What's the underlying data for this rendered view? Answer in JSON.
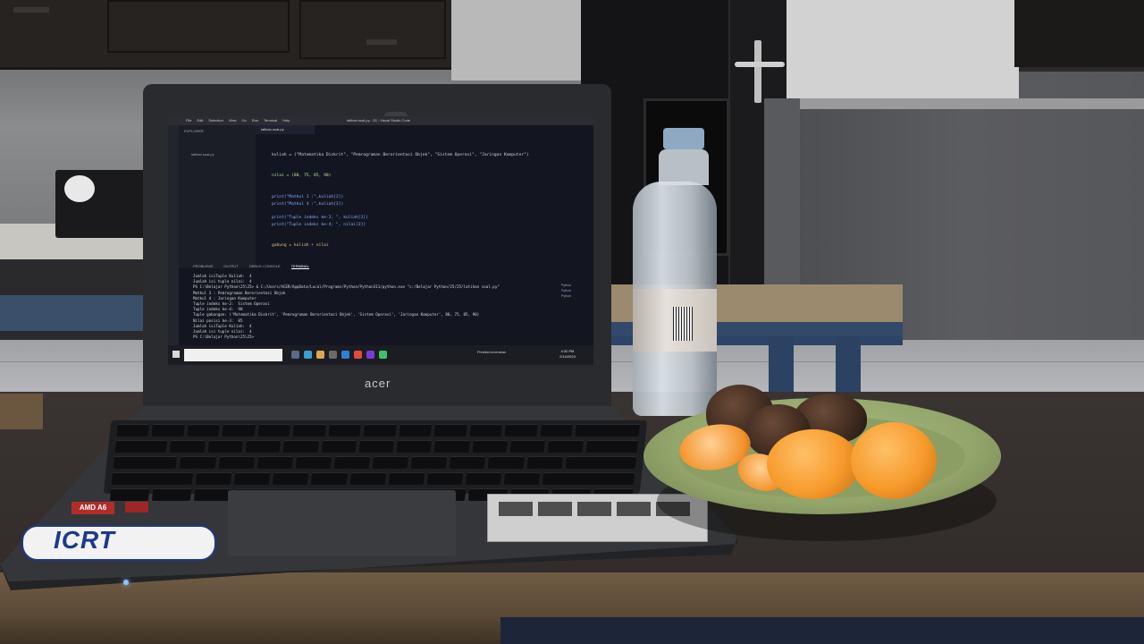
{
  "scene": {
    "laptop_brand": "acer",
    "sticker_badge": "AMD A6",
    "sticker_brand": "ICRT"
  },
  "vscode": {
    "menu": [
      "File",
      "Edit",
      "Selection",
      "View",
      "Go",
      "Run",
      "Terminal",
      "Help"
    ],
    "window_title": "latihan soal.py - 25 - Visual Studio Code",
    "explorer_header": "EXPLORER",
    "explorer_file": "latihan soal.py",
    "active_tab": "latihan soal.py",
    "code_lines": [
      "kuliah = (\"Matematika Diskrit\", \"Pemrograman Berorientasi Objek\", \"Sistem Operasi\", \"Jaringan Komputer\")",
      "",
      "",
      "nilai = (80, 75, 85, 90)",
      "",
      "",
      "print(\"Matkul 3 :\",kuliah[2])",
      "print(\"Matkul 4 :\",kuliah[3])",
      "",
      "print(\"Tuple indeks ke-2; \", kuliah[2])",
      "print(\"Tuple indeks ke-4; \", nilai[3])",
      "",
      "",
      "gabung = kuliah + nilai"
    ],
    "panel_tabs": [
      "PROBLEMS",
      "OUTPUT",
      "DEBUG CONSOLE",
      "TERMINAL"
    ],
    "terminal_lines": [
      "Jumlah isiTuple Kuliah:  4",
      "Jumlah isi tuple nilai:  4",
      "PS C:\\Belajar Python\\25\\25> & C:/Users/ACER/AppData/Local/Programs/Python/Python311/python.exe \"c:/Belajar Python/25/25/latihan soal.py\"",
      "Matkul 3 : Pemrograman Berorientasi Objek",
      "Matkul 4 : Jaringan Komputer",
      "Tuple indeks ke-2:  Sistem Operasi",
      "Tuple indeks ke-4:  90",
      "Tuple gabungan: ('Matematika Diskrit', 'Pemrograman Berorientasi Objek', 'Sistem Operasi', 'Jaringan Komputer', 80, 75, 85, 90)",
      "Nilai posisi ke-3:  85",
      "Jumlah isiTuple Kuliah:  4",
      "Jumlah isi tuple nilai:  4",
      "PS C:\\Belajar Python\\25\\25>"
    ],
    "terminal_side": [
      "Python",
      "Python",
      "Python"
    ],
    "taskbar_tray": "Prediksi kecerahan",
    "clock_time": "4:32 PM",
    "clock_date": "2/14/2023"
  },
  "colors": {
    "wall": "#8b8c8e",
    "table": "#393431",
    "plate": "#a9bb7f",
    "orange": "#f79a2b",
    "bench_blue": "#33496a"
  }
}
